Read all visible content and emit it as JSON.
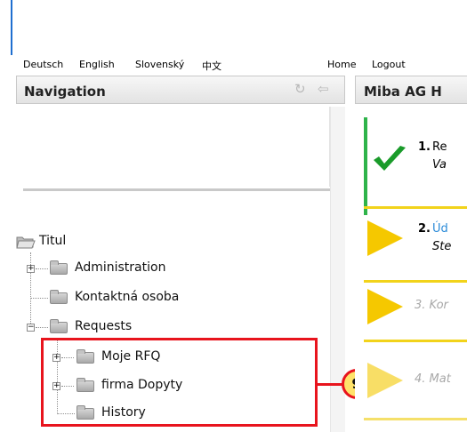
{
  "languages": [
    "Deutsch",
    "English",
    "Slovenský",
    "中文"
  ],
  "top_links": {
    "home": "Home",
    "logout": "Logout"
  },
  "navigation": {
    "title": "Navigation",
    "tree": {
      "root": "Titul",
      "items": [
        "Administration",
        "Kontaktná osoba",
        "Requests"
      ],
      "requests_children": [
        "Moje RFQ",
        "firma Dopyty",
        "History"
      ]
    }
  },
  "right_panel": {
    "title": "Miba AG H",
    "steps": [
      {
        "number": "1.",
        "title": "Re",
        "subtitle": "Va"
      },
      {
        "number": "2.",
        "title": "Úd",
        "subtitle": "Ste"
      },
      {
        "number": "",
        "title": "3. Kor",
        "subtitle": ""
      },
      {
        "number": "",
        "title": "4. Mat",
        "subtitle": ""
      }
    ]
  },
  "callout": {
    "label": "9"
  },
  "colors": {
    "accent_red": "#e8141d",
    "callout_yellow": "#ffe36a",
    "step_yellow": "#f5c800",
    "check_green": "#1a9b2a",
    "link_blue": "#2a8ad8"
  }
}
